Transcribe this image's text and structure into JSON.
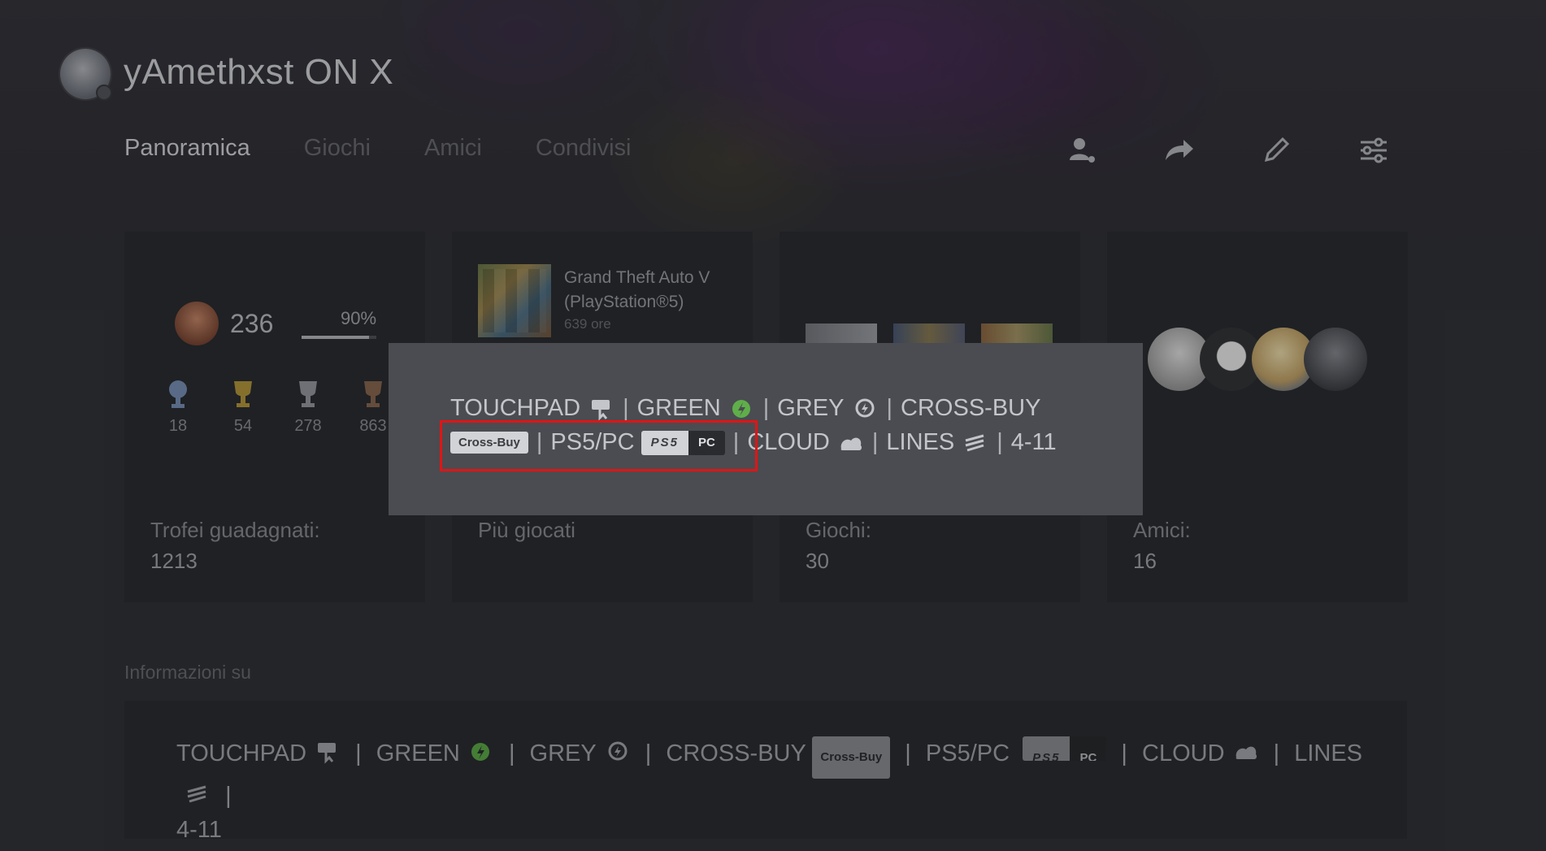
{
  "profile": {
    "username": "yAmethxst ON X"
  },
  "tabs": [
    {
      "label": "Panoramica",
      "active": true
    },
    {
      "label": "Giochi",
      "active": false
    },
    {
      "label": "Amici",
      "active": false
    },
    {
      "label": "Condivisi",
      "active": false
    }
  ],
  "toolbar": {
    "icons": [
      "add-friend-icon",
      "share-icon",
      "edit-icon",
      "settings-sliders-icon"
    ]
  },
  "trophies": {
    "level": "236",
    "progress_label": "90%",
    "progress": 0.9,
    "platinum": "18",
    "gold": "54",
    "silver": "278",
    "bronze": "863",
    "label": "Trofei guadagnati:",
    "total": "1213"
  },
  "most_played": {
    "title": "Grand Theft Auto V (PlayStation®5)",
    "hours": "639 ore",
    "label": "Più giocati"
  },
  "games": {
    "label": "Giochi:",
    "count": "30"
  },
  "friends": {
    "label": "Amici:",
    "count": "16"
  },
  "about_popup": {
    "touchpad": "TOUCHPAD",
    "green": "GREEN",
    "grey": "GREY",
    "cross_buy": "CROSS-BUY",
    "cross_buy_badge": "Cross-Buy",
    "ps5_pc": "PS5/PC",
    "ps5_badge": "PS5",
    "pc_badge": "PC",
    "cloud": "CLOUD",
    "lines": "LINES",
    "range": "4-11",
    "separator": "|"
  },
  "about": {
    "heading": "Informazioni su",
    "touchpad": "TOUCHPAD",
    "green": "GREEN",
    "grey": "GREY",
    "cross_buy": "CROSS-BUY",
    "cross_buy_badge": "Cross-Buy",
    "ps5_pc": "PS5/PC",
    "ps5_badge": "PS5",
    "pc_badge": "PC",
    "cloud": "CLOUD",
    "lines": "LINES",
    "range": "4-11",
    "separator": "|"
  },
  "colors": {
    "highlight_border": "#e01515",
    "green_icon": "#5fae4a"
  }
}
